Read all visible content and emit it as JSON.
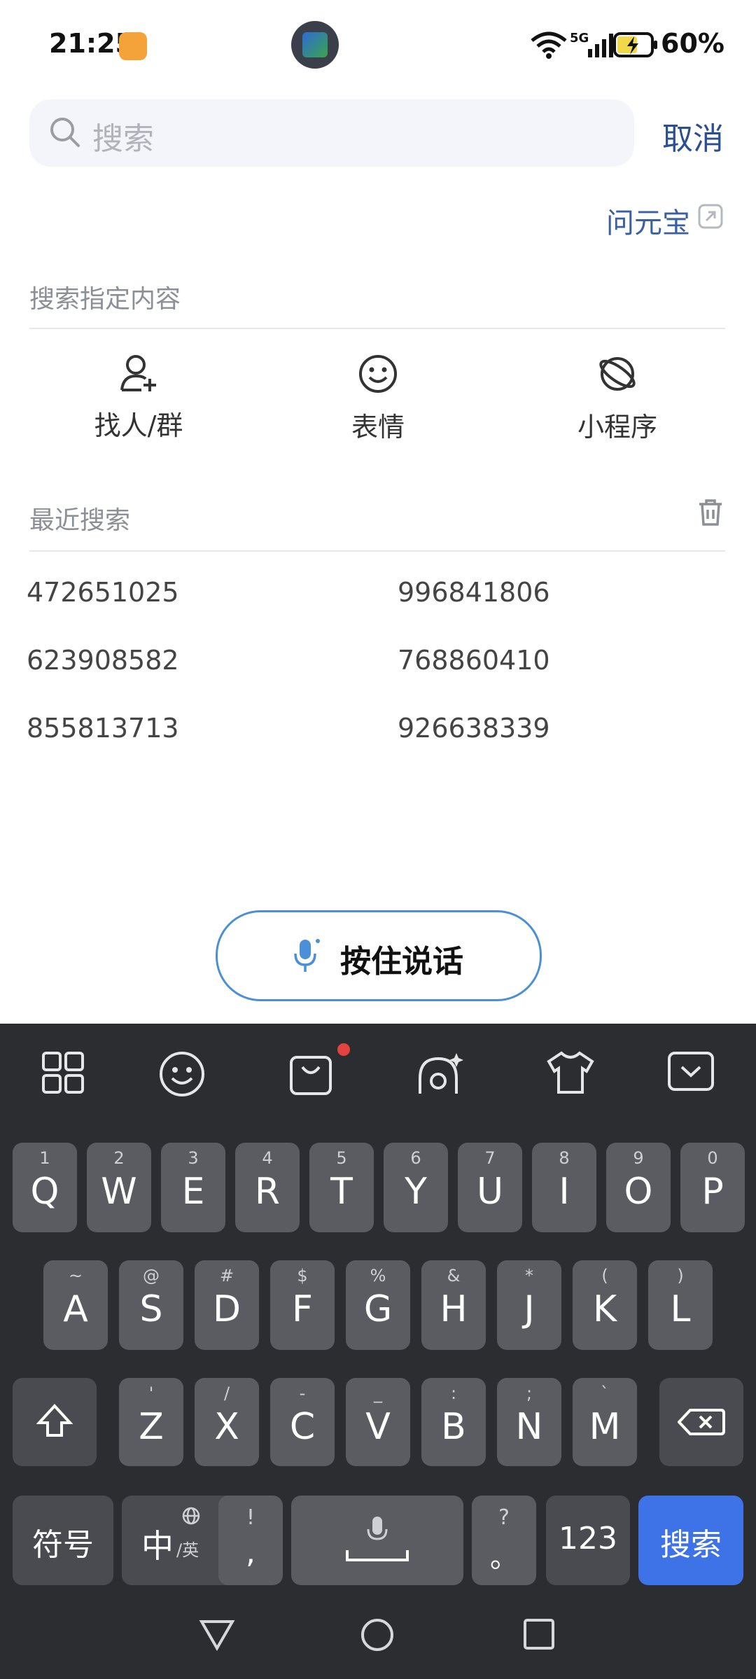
{
  "status_bar": {
    "time": "21:25",
    "battery_pct": "60%",
    "network": "5G"
  },
  "search": {
    "placeholder": "搜索",
    "cancel_label": "取消"
  },
  "assistant_link": {
    "label": "问元宝"
  },
  "specified": {
    "title": "搜索指定内容",
    "categories": [
      {
        "label": "找人/群",
        "icon": "add-person-icon"
      },
      {
        "label": "表情",
        "icon": "smiley-icon"
      },
      {
        "label": "小程序",
        "icon": "planet-icon"
      }
    ]
  },
  "recent": {
    "title": "最近搜索",
    "items": [
      "472651025",
      "996841806",
      "623908582",
      "768860410",
      "855813713",
      "926638339"
    ]
  },
  "voice": {
    "label": "按住说话"
  },
  "keyboard": {
    "row1": [
      {
        "k": "Q",
        "s": "1"
      },
      {
        "k": "W",
        "s": "2"
      },
      {
        "k": "E",
        "s": "3"
      },
      {
        "k": "R",
        "s": "4"
      },
      {
        "k": "T",
        "s": "5"
      },
      {
        "k": "Y",
        "s": "6"
      },
      {
        "k": "U",
        "s": "7"
      },
      {
        "k": "I",
        "s": "8"
      },
      {
        "k": "O",
        "s": "9"
      },
      {
        "k": "P",
        "s": "0"
      }
    ],
    "row2": [
      {
        "k": "A",
        "s": "~"
      },
      {
        "k": "S",
        "s": "@"
      },
      {
        "k": "D",
        "s": "#"
      },
      {
        "k": "F",
        "s": "$"
      },
      {
        "k": "G",
        "s": "%"
      },
      {
        "k": "H",
        "s": "&"
      },
      {
        "k": "J",
        "s": "*"
      },
      {
        "k": "K",
        "s": "("
      },
      {
        "k": "L",
        "s": ")"
      }
    ],
    "row3": [
      {
        "k": "Z",
        "s": "'"
      },
      {
        "k": "X",
        "s": "/"
      },
      {
        "k": "C",
        "s": "-"
      },
      {
        "k": "V",
        "s": "_"
      },
      {
        "k": "B",
        "s": ":"
      },
      {
        "k": "N",
        "s": ";"
      },
      {
        "k": "M",
        "s": "`"
      }
    ],
    "symbols_label": "符号",
    "lang_main": "中",
    "lang_sub": "/英",
    "comma_main": ",",
    "comma_sub": "!",
    "period_main": "。",
    "period_sub": "?",
    "num_label": "123",
    "search_label": "搜索"
  },
  "colors": {
    "accent": "#3d73e6",
    "link": "#2b4f93",
    "keyboard_bg": "#2c2d31",
    "key_bg": "#5b5c62"
  }
}
